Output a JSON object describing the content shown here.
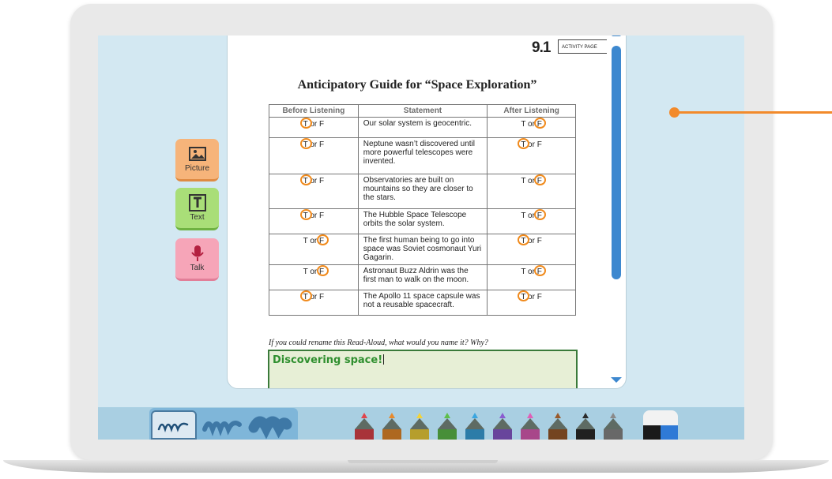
{
  "document": {
    "page_number": "9.1",
    "page_badge": "ACTIVITY PAGE",
    "title": "Anticipatory Guide for “Space Exploration”",
    "columns": [
      "Before Listening",
      "Statement",
      "After Listening"
    ],
    "rows": [
      {
        "statement": "Our solar system is geocentric.",
        "before": "T or F",
        "before_circled": "T",
        "after": "T or F",
        "after_circled": "F"
      },
      {
        "statement": "Neptune wasn’t discovered until more powerful telescopes were invented.",
        "before": "T or F",
        "before_circled": "T",
        "after": "T or F",
        "after_circled": "T"
      },
      {
        "statement": "Observatories are built on mountains so they are closer to the stars.",
        "before": "T or F",
        "before_circled": "T",
        "after": "T or F",
        "after_circled": "F"
      },
      {
        "statement": "The Hubble Space Telescope orbits the solar system.",
        "before": "T or F",
        "before_circled": "T",
        "after": "T or F",
        "after_circled": "F"
      },
      {
        "statement": "The first human being to go into space was Soviet cosmonaut Yuri Gagarin.",
        "before": "T or F",
        "before_circled": "F",
        "after": "T or F",
        "after_circled": "T"
      },
      {
        "statement": "Astronaut Buzz Aldrin was the first man to walk on the moon.",
        "before": "T or F",
        "before_circled": "F",
        "after": "T or F",
        "after_circled": "F"
      },
      {
        "statement": "The Apollo 11 space capsule was not a reusable spacecraft.",
        "before": "T or F",
        "before_circled": "T",
        "after": "T or F",
        "after_circled": "T"
      }
    ],
    "question": "If you could rename this Read-Aloud, what would you name it? Why?",
    "answer": "Discovering space!"
  },
  "side_tools": [
    {
      "label": "Picture",
      "icon": "picture-icon"
    },
    {
      "label": "Text",
      "icon": "text-icon"
    },
    {
      "label": "Talk",
      "icon": "microphone-icon"
    }
  ],
  "toolbar": {
    "brush_sizes": [
      "thin",
      "medium",
      "thick"
    ],
    "brush_selected": "thin",
    "marker_colors": [
      "#e0444c",
      "#e88a2b",
      "#f3d33a",
      "#5fbf4a",
      "#3aa6e0",
      "#8a5cd0",
      "#e05fb8",
      "#9a5a2a",
      "#2a2a2a",
      "#8a8a8a"
    ],
    "marker_body": "#5e6b63",
    "eraser": "eraser-icon"
  },
  "colors": {
    "screen_bg": "#d3e8f2",
    "circle": "#f08a1c",
    "answer_text": "#2f8f2f",
    "callout": "#f28a2b",
    "scrollbar": "#3d88cf"
  }
}
